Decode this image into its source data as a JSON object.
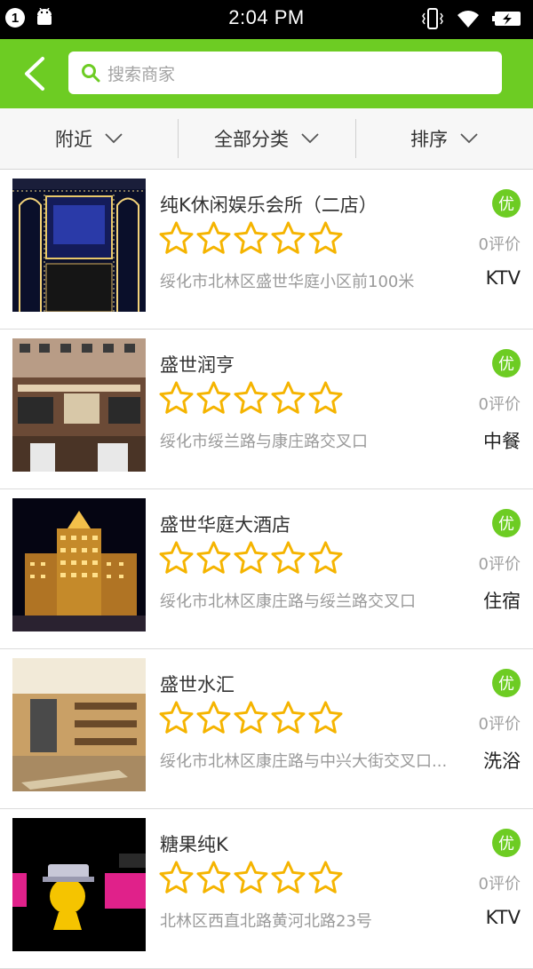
{
  "status_bar": {
    "notification_count": "1",
    "time": "2:04 PM"
  },
  "header": {
    "search_placeholder": "搜索商家"
  },
  "filters": [
    {
      "label": "附近"
    },
    {
      "label": "全部分类"
    },
    {
      "label": "排序"
    }
  ],
  "colors": {
    "accent": "#6dcc23",
    "star": "#f5b400"
  },
  "merchants": [
    {
      "name": "纯K休闲娱乐会所（二店）",
      "rating": 0,
      "address": "绥化市北林区盛世华庭小区前100米",
      "badge": "优",
      "reviews": "0评价",
      "category": "KTV"
    },
    {
      "name": "盛世润亨",
      "rating": 0,
      "address": "绥化市绥兰路与康庄路交叉口",
      "badge": "优",
      "reviews": "0评价",
      "category": "中餐"
    },
    {
      "name": "盛世华庭大酒店",
      "rating": 0,
      "address": "绥化市北林区康庄路与绥兰路交叉口",
      "badge": "优",
      "reviews": "0评价",
      "category": "住宿"
    },
    {
      "name": "盛世水汇",
      "rating": 0,
      "address": "绥化市北林区康庄路与中兴大街交叉口...",
      "badge": "优",
      "reviews": "0评价",
      "category": "洗浴"
    },
    {
      "name": "糖果纯K",
      "rating": 0,
      "address": "北林区西直北路黄河北路23号",
      "badge": "优",
      "reviews": "0评价",
      "category": "KTV"
    }
  ]
}
